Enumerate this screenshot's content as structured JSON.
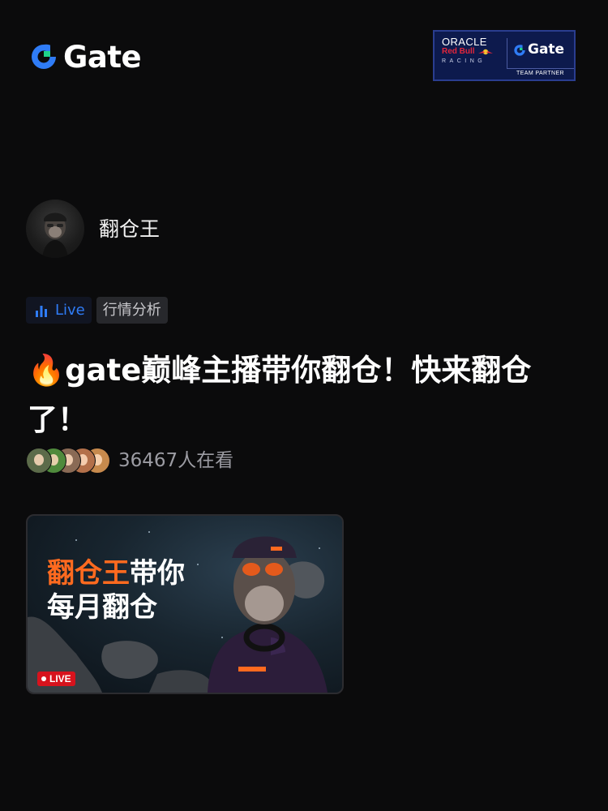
{
  "brand": {
    "logo_text": "Gate",
    "logo_icon": "gate-logo-icon",
    "accent_color": "#2f7cf6"
  },
  "partner_badge": {
    "line1": "ORACLE",
    "line2": "Red Bull",
    "line3": "RACING",
    "brand": "Gate",
    "footer": "TEAM PARTNER"
  },
  "host": {
    "name": "翻仓王",
    "avatar_icon": "ape-avatar"
  },
  "tags": {
    "live_label": "Live",
    "live_icon": "bar-chart-icon",
    "category": "行情分析"
  },
  "stream": {
    "title": "🔥gate巅峰主播带你翻仓！快来翻仓了！",
    "viewer_count": "36467人在看",
    "viewer_avatars": [
      "#5c6b4a",
      "#4f8a3c",
      "#8a6a55",
      "#b3704a",
      "#c78a4d"
    ]
  },
  "thumbnail": {
    "line1_accent": "翻仓王",
    "line1_rest": "带你",
    "line2": "每月翻仓",
    "live_badge": "LIVE",
    "accent_color": "#ff6a1f"
  }
}
